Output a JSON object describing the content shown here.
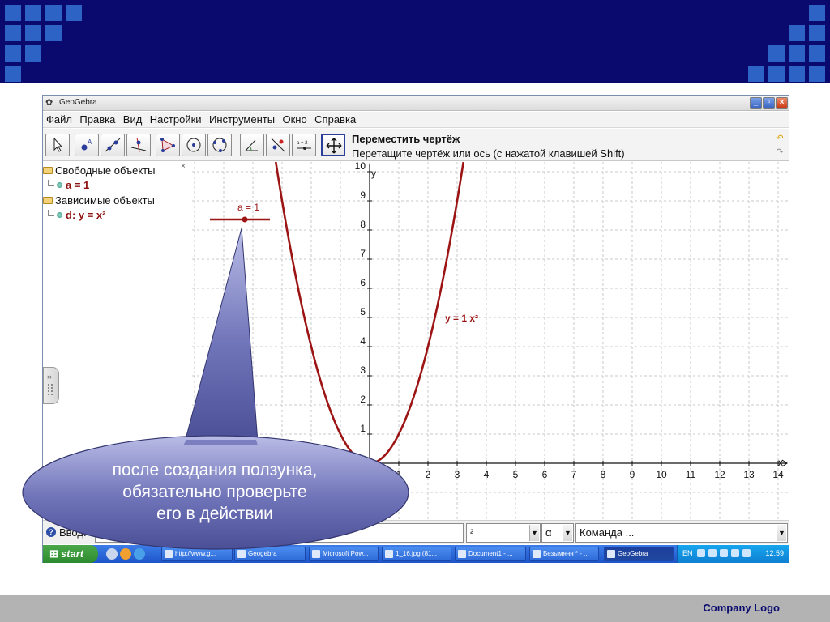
{
  "slide": {
    "footer_logo": "Company  Logo",
    "colors": {
      "header_band": "#0a0a6e",
      "header_squares": "#2e63c6",
      "footer_band": "#b3b3b3",
      "callout_fill": "#5f62a8",
      "curve": "#9c1414"
    }
  },
  "window": {
    "title": "GeoGebra",
    "icons": [
      "geogebra-icon",
      "minimize-icon",
      "maximize-icon",
      "close-icon"
    ]
  },
  "menu": [
    "Файл",
    "Правка",
    "Вид",
    "Настройки",
    "Инструменты",
    "Окно",
    "Справка"
  ],
  "toolbar": {
    "tools": [
      "move-tool-icon",
      "point-tool-icon",
      "line-tool-icon",
      "perpendicular-tool-icon",
      "polygon-tool-icon",
      "circle-tool-icon",
      "circle-three-points-tool-icon",
      "angle-tool-icon",
      "reflect-tool-icon",
      "slider-tool-icon",
      "move-graphics-tool-icon"
    ],
    "slider_tool_text": "a = 2",
    "active_tool_title": "Переместить чертёж",
    "active_tool_help": "Перетащите чертёж или ось (с нажатой клавишей Shift)"
  },
  "algebra": {
    "free_objects": "Свободные объекты",
    "free_items": [
      "a = 1"
    ],
    "dependent_objects": "Зависимые объекты",
    "dependent_items": [
      "d: y = x²"
    ],
    "close_glyph": "×"
  },
  "graphics": {
    "x_axis_label": "x",
    "y_axis_label": "y",
    "x_ticks": [
      "1",
      "2",
      "3",
      "4",
      "5",
      "6",
      "7",
      "8",
      "9",
      "10",
      "11",
      "12",
      "13",
      "14"
    ],
    "y_ticks": [
      "1",
      "2",
      "3",
      "4",
      "5",
      "6",
      "7",
      "8",
      "9",
      "10"
    ],
    "curve_label": "y = 1 x²",
    "slider_label": "a = 1",
    "slider_value": 1
  },
  "input_bar": {
    "label": "Ввод:",
    "power_symbol": "²",
    "greek_symbol": "α",
    "command_placeholder": "Команда ..."
  },
  "taskbar": {
    "start": "start",
    "tasks": [
      "http://www.g...",
      "Geogebra",
      "Microsoft Pow...",
      "1_16.jpg (81...",
      "Document1 - ...",
      "Безымянн * - ...",
      "GeoGebra"
    ],
    "active_task": 6,
    "language": "EN",
    "clock": "12:59"
  },
  "callout": {
    "lines": [
      "после создания ползунка,",
      "обязательно проверьте",
      "его в действии"
    ]
  }
}
